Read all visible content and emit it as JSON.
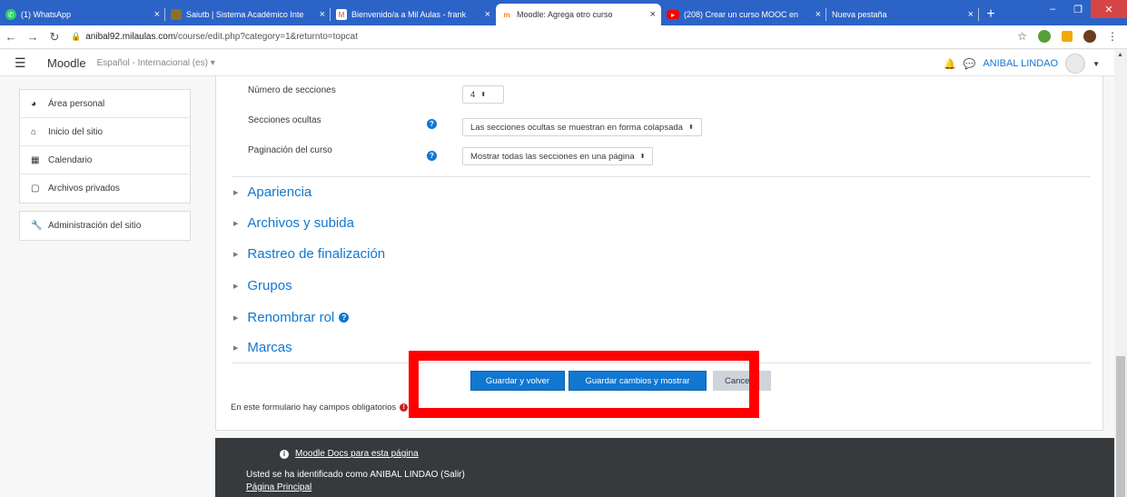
{
  "browser": {
    "tabs": [
      {
        "title": "(1) WhatsApp",
        "favicon_color": "#25d366",
        "active": false
      },
      {
        "title": "Saiutb | Sistema Académico Inte",
        "favicon_color": "#8b6f2e",
        "active": false
      },
      {
        "title": "Bienvenido/a a Mil Aulas - frank",
        "favicon_color": "#d44638",
        "active": false
      },
      {
        "title": "Moodle: Agrega otro curso",
        "favicon_color": "#f98012",
        "active": true
      },
      {
        "title": "(208) Crear un curso MOOC en",
        "favicon_color": "#ff0000",
        "active": false
      },
      {
        "title": "Nueva pestaña",
        "favicon_color": "",
        "active": false
      }
    ],
    "url_host": "anibal92.milaulas.com",
    "url_path": "/course/edit.php?category=1&returnto=topcat"
  },
  "navbar": {
    "brand": "Moodle",
    "language": "Español - Internacional (es) ▾",
    "user_name": "ANIBAL LINDAO"
  },
  "sidebar": {
    "group1": [
      {
        "label": "Área personal",
        "icon": "dashboard-icon"
      },
      {
        "label": "Inicio del sitio",
        "icon": "home-icon"
      },
      {
        "label": "Calendario",
        "icon": "calendar-icon"
      },
      {
        "label": "Archivos privados",
        "icon": "file-icon"
      }
    ],
    "group2": [
      {
        "label": "Administración del sitio",
        "icon": "wrench-icon"
      }
    ]
  },
  "form": {
    "fields": [
      {
        "label": "Número de secciones",
        "value": "4",
        "help": false
      },
      {
        "label": "Secciones ocultas",
        "value": "Las secciones ocultas se muestran en forma colapsada",
        "help": true
      },
      {
        "label": "Paginación del curso",
        "value": "Mostrar todas las secciones en una página",
        "help": true
      }
    ],
    "sections": [
      {
        "label": "Apariencia",
        "help": false
      },
      {
        "label": "Archivos y subida",
        "help": false
      },
      {
        "label": "Rastreo de finalización",
        "help": false
      },
      {
        "label": "Grupos",
        "help": false
      },
      {
        "label": "Renombrar rol",
        "help": true
      },
      {
        "label": "Marcas",
        "help": false
      }
    ],
    "buttons": {
      "save_return": "Guardar y volver",
      "save_display": "Guardar cambios y mostrar",
      "cancel": "Cancelar"
    },
    "required_note": "En este formulario hay campos obligatorios"
  },
  "footer": {
    "docs_link": "Moodle Docs para esta página",
    "logged_in": "Usted se ha identificado como ANIBAL LINDAO (Salir)",
    "home_link": "Página Principal"
  },
  "colors": {
    "accent": "#1177d1",
    "annotation": "#ff0000",
    "footer_bg": "#373a3c",
    "tabbar_bg": "#2c63c7"
  }
}
